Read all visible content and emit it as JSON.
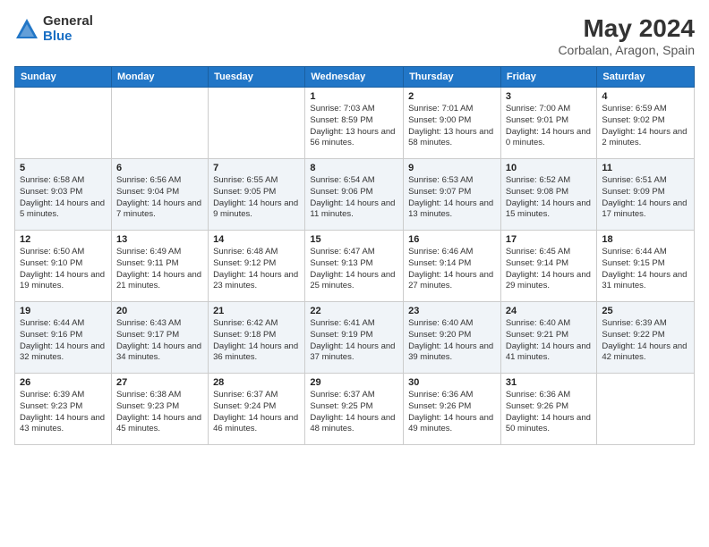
{
  "logo": {
    "general": "General",
    "blue": "Blue"
  },
  "title": "May 2024",
  "subtitle": "Corbalan, Aragon, Spain",
  "headers": [
    "Sunday",
    "Monday",
    "Tuesday",
    "Wednesday",
    "Thursday",
    "Friday",
    "Saturday"
  ],
  "weeks": [
    [
      {
        "day": "",
        "info": ""
      },
      {
        "day": "",
        "info": ""
      },
      {
        "day": "",
        "info": ""
      },
      {
        "day": "1",
        "info": "Sunrise: 7:03 AM\nSunset: 8:59 PM\nDaylight: 13 hours and 56 minutes."
      },
      {
        "day": "2",
        "info": "Sunrise: 7:01 AM\nSunset: 9:00 PM\nDaylight: 13 hours and 58 minutes."
      },
      {
        "day": "3",
        "info": "Sunrise: 7:00 AM\nSunset: 9:01 PM\nDaylight: 14 hours and 0 minutes."
      },
      {
        "day": "4",
        "info": "Sunrise: 6:59 AM\nSunset: 9:02 PM\nDaylight: 14 hours and 2 minutes."
      }
    ],
    [
      {
        "day": "5",
        "info": "Sunrise: 6:58 AM\nSunset: 9:03 PM\nDaylight: 14 hours and 5 minutes."
      },
      {
        "day": "6",
        "info": "Sunrise: 6:56 AM\nSunset: 9:04 PM\nDaylight: 14 hours and 7 minutes."
      },
      {
        "day": "7",
        "info": "Sunrise: 6:55 AM\nSunset: 9:05 PM\nDaylight: 14 hours and 9 minutes."
      },
      {
        "day": "8",
        "info": "Sunrise: 6:54 AM\nSunset: 9:06 PM\nDaylight: 14 hours and 11 minutes."
      },
      {
        "day": "9",
        "info": "Sunrise: 6:53 AM\nSunset: 9:07 PM\nDaylight: 14 hours and 13 minutes."
      },
      {
        "day": "10",
        "info": "Sunrise: 6:52 AM\nSunset: 9:08 PM\nDaylight: 14 hours and 15 minutes."
      },
      {
        "day": "11",
        "info": "Sunrise: 6:51 AM\nSunset: 9:09 PM\nDaylight: 14 hours and 17 minutes."
      }
    ],
    [
      {
        "day": "12",
        "info": "Sunrise: 6:50 AM\nSunset: 9:10 PM\nDaylight: 14 hours and 19 minutes."
      },
      {
        "day": "13",
        "info": "Sunrise: 6:49 AM\nSunset: 9:11 PM\nDaylight: 14 hours and 21 minutes."
      },
      {
        "day": "14",
        "info": "Sunrise: 6:48 AM\nSunset: 9:12 PM\nDaylight: 14 hours and 23 minutes."
      },
      {
        "day": "15",
        "info": "Sunrise: 6:47 AM\nSunset: 9:13 PM\nDaylight: 14 hours and 25 minutes."
      },
      {
        "day": "16",
        "info": "Sunrise: 6:46 AM\nSunset: 9:14 PM\nDaylight: 14 hours and 27 minutes."
      },
      {
        "day": "17",
        "info": "Sunrise: 6:45 AM\nSunset: 9:14 PM\nDaylight: 14 hours and 29 minutes."
      },
      {
        "day": "18",
        "info": "Sunrise: 6:44 AM\nSunset: 9:15 PM\nDaylight: 14 hours and 31 minutes."
      }
    ],
    [
      {
        "day": "19",
        "info": "Sunrise: 6:44 AM\nSunset: 9:16 PM\nDaylight: 14 hours and 32 minutes."
      },
      {
        "day": "20",
        "info": "Sunrise: 6:43 AM\nSunset: 9:17 PM\nDaylight: 14 hours and 34 minutes."
      },
      {
        "day": "21",
        "info": "Sunrise: 6:42 AM\nSunset: 9:18 PM\nDaylight: 14 hours and 36 minutes."
      },
      {
        "day": "22",
        "info": "Sunrise: 6:41 AM\nSunset: 9:19 PM\nDaylight: 14 hours and 37 minutes."
      },
      {
        "day": "23",
        "info": "Sunrise: 6:40 AM\nSunset: 9:20 PM\nDaylight: 14 hours and 39 minutes."
      },
      {
        "day": "24",
        "info": "Sunrise: 6:40 AM\nSunset: 9:21 PM\nDaylight: 14 hours and 41 minutes."
      },
      {
        "day": "25",
        "info": "Sunrise: 6:39 AM\nSunset: 9:22 PM\nDaylight: 14 hours and 42 minutes."
      }
    ],
    [
      {
        "day": "26",
        "info": "Sunrise: 6:39 AM\nSunset: 9:23 PM\nDaylight: 14 hours and 43 minutes."
      },
      {
        "day": "27",
        "info": "Sunrise: 6:38 AM\nSunset: 9:23 PM\nDaylight: 14 hours and 45 minutes."
      },
      {
        "day": "28",
        "info": "Sunrise: 6:37 AM\nSunset: 9:24 PM\nDaylight: 14 hours and 46 minutes."
      },
      {
        "day": "29",
        "info": "Sunrise: 6:37 AM\nSunset: 9:25 PM\nDaylight: 14 hours and 48 minutes."
      },
      {
        "day": "30",
        "info": "Sunrise: 6:36 AM\nSunset: 9:26 PM\nDaylight: 14 hours and 49 minutes."
      },
      {
        "day": "31",
        "info": "Sunrise: 6:36 AM\nSunset: 9:26 PM\nDaylight: 14 hours and 50 minutes."
      },
      {
        "day": "",
        "info": ""
      }
    ]
  ]
}
